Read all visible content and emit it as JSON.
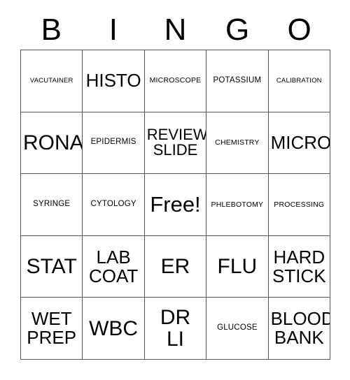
{
  "card": {
    "header": {
      "letters": [
        "B",
        "I",
        "N",
        "G",
        "O"
      ]
    },
    "columns": [
      "B",
      "I",
      "N",
      "G",
      "O"
    ],
    "rows": [
      {
        "cells": [
          {
            "text": "VACUTAINER",
            "size": "xs",
            "free": false
          },
          {
            "text": "HISTO",
            "size": "xl",
            "free": false
          },
          {
            "text": "MICROSCOPE",
            "size": "sm",
            "free": false
          },
          {
            "text": "POTASSIUM",
            "size": "md",
            "free": false
          },
          {
            "text": "CALIBRATION",
            "size": "xs",
            "free": false
          }
        ]
      },
      {
        "cells": [
          {
            "text": "RONA",
            "size": "xxl",
            "free": false
          },
          {
            "text": "EPIDERMIS",
            "size": "md",
            "free": false
          },
          {
            "text": "REVIEW\nSLIDE",
            "size": "lg",
            "free": false
          },
          {
            "text": "CHEMISTRY",
            "size": "sm",
            "free": false
          },
          {
            "text": "MICRO",
            "size": "xl",
            "free": false
          }
        ]
      },
      {
        "cells": [
          {
            "text": "SYRINGE",
            "size": "md",
            "free": false
          },
          {
            "text": "CYTOLOGY",
            "size": "md",
            "free": false
          },
          {
            "text": "Free!",
            "size": "free",
            "free": true
          },
          {
            "text": "PHLEBOTOMY",
            "size": "sm",
            "free": false
          },
          {
            "text": "PROCESSING",
            "size": "sm",
            "free": false
          }
        ]
      },
      {
        "cells": [
          {
            "text": "STAT",
            "size": "xxl",
            "free": false
          },
          {
            "text": "LAB\nCOAT",
            "size": "xl",
            "free": false
          },
          {
            "text": "ER",
            "size": "xxl",
            "free": false
          },
          {
            "text": "FLU",
            "size": "xxl",
            "free": false
          },
          {
            "text": "HARD\nSTICK",
            "size": "xl",
            "free": false
          }
        ]
      },
      {
        "cells": [
          {
            "text": "WET\nPREP",
            "size": "xl",
            "free": false
          },
          {
            "text": "WBC",
            "size": "xxl",
            "free": false
          },
          {
            "text": "DR\nLI",
            "size": "xxl",
            "free": false
          },
          {
            "text": "GLUCOSE",
            "size": "md",
            "free": false
          },
          {
            "text": "BLOOD\nBANK",
            "size": "xl",
            "free": false
          }
        ]
      }
    ]
  },
  "colors": {
    "page_background": "#ffffff",
    "cell_background": "#ffffff",
    "grid_line": "#555555",
    "text": "#000000"
  }
}
